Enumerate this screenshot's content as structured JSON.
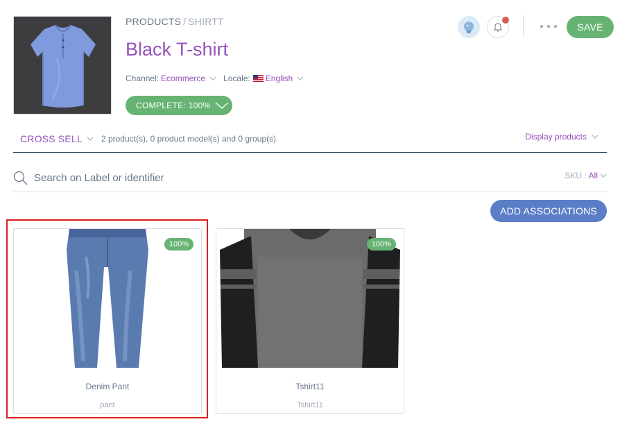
{
  "header": {
    "breadcrumb": {
      "root": "PRODUCTS",
      "separator": "/",
      "current": "SHIRTT"
    },
    "title": "Black T-shirt",
    "channel_label": "Channel:",
    "channel_value": "Ecommerce",
    "locale_label": "Locale:",
    "locale_value": "English",
    "completeness": "COMPLETE: 100%",
    "save_label": "SAVE"
  },
  "associations": {
    "type": "CROSS SELL",
    "summary": "2 product(s), 0 product model(s) and 0 group(s)",
    "display_toggle": "Display products",
    "search_placeholder": "Search on Label or identifier",
    "sku_label": "SKU :",
    "sku_value": "All",
    "add_button": "ADD ASSOCIATIONS"
  },
  "products": [
    {
      "label": "Denim Pant",
      "identifier": "pant",
      "completeness": "100%"
    },
    {
      "label": "Tshirt11",
      "identifier": "Tshirt11",
      "completeness": "100%"
    }
  ],
  "colors": {
    "brand_purple": "#9452ba",
    "success_green": "#67b373",
    "action_blue": "#5b7ec7",
    "highlight_red": "#e01d1d"
  }
}
